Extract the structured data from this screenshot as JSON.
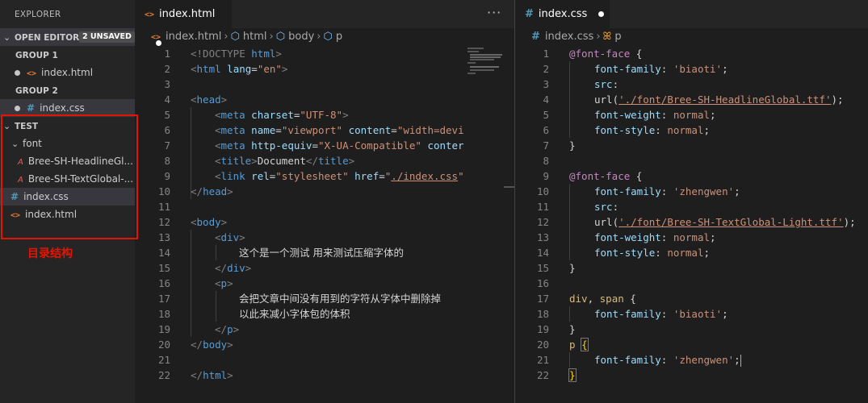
{
  "sidebar": {
    "title": "EXPLORER",
    "open_editors": {
      "label": "OPEN EDITORS",
      "badge": "2 UNSAVED"
    },
    "group1": {
      "label": "GROUP 1",
      "file": "index.html"
    },
    "group2": {
      "label": "GROUP 2",
      "file": "index.css"
    },
    "project": {
      "label": "TEST"
    },
    "tree": {
      "folder": "font",
      "font_files": [
        "Bree-SH-HeadlineGl...",
        "Bree-SH-TextGlobal-..."
      ],
      "css_file": "index.css",
      "html_file": "index.html"
    },
    "annotation": "目录结构"
  },
  "left_editor": {
    "tab": "index.html",
    "more": "···",
    "breadcrumb": [
      "index.html",
      "html",
      "body",
      "p"
    ],
    "line_numbers": [
      "1",
      "2",
      "3",
      "4",
      "5",
      "6",
      "7",
      "8",
      "9",
      "10",
      "11",
      "12",
      "13",
      "14",
      "15",
      "16",
      "17",
      "18",
      "19",
      "20",
      "21",
      "22"
    ]
  },
  "right_editor": {
    "tab": "index.css",
    "breadcrumb": [
      "index.css",
      "p"
    ],
    "line_numbers": [
      "1",
      "2",
      "3",
      "4",
      "5",
      "6",
      "7",
      "8",
      "9",
      "10",
      "11",
      "12",
      "13",
      "14",
      "15",
      "16",
      "17",
      "18",
      "19",
      "20",
      "21",
      "22"
    ]
  },
  "html_code": {
    "l1a": "<!DOCTYPE ",
    "l1b": "html",
    "l1c": ">",
    "l2a": "<",
    "l2b": "html",
    "l2c": " lang",
    "l2d": "=",
    "l2e": "\"en\"",
    "l2f": ">",
    "l4a": "<",
    "l4b": "head",
    "l4c": ">",
    "l5a": "<",
    "l5b": "meta",
    "l5c": " charset",
    "l5d": "=",
    "l5e": "\"UTF-8\"",
    "l5f": ">",
    "l6a": "<",
    "l6b": "meta",
    "l6c": " name",
    "l6d": "=",
    "l6e": "\"viewport\"",
    "l6f": " content",
    "l6g": "=",
    "l6h": "\"width=devi",
    "l7a": "<",
    "l7b": "meta",
    "l7c": " http-equiv",
    "l7d": "=",
    "l7e": "\"X-UA-Compatible\"",
    "l7f": " conter",
    "l8a": "<",
    "l8b": "title",
    "l8c": ">",
    "l8d": "Document",
    "l8e": "</",
    "l8f": "title",
    "l8g": ">",
    "l9a": "<",
    "l9b": "link",
    "l9c": " rel",
    "l9d": "=",
    "l9e": "\"stylesheet\"",
    "l9f": " href",
    "l9g": "=",
    "l9h": "\"",
    "l9i": "./index.css",
    "l9j": "\"",
    "l10a": "</",
    "l10b": "head",
    "l10c": ">",
    "l12a": "<",
    "l12b": "body",
    "l12c": ">",
    "l13a": "<",
    "l13b": "div",
    "l13c": ">",
    "l14": "这个是一个测试 用来测试压缩字体的",
    "l15a": "</",
    "l15b": "div",
    "l15c": ">",
    "l16a": "<",
    "l16b": "p",
    "l16c": ">",
    "l17": "会把文章中间没有用到的字符从字体中删除掉",
    "l18": "以此来减小字体包的体积",
    "l19a": "</",
    "l19b": "p",
    "l19c": ">",
    "l20a": "</",
    "l20b": "body",
    "l20c": ">",
    "l22a": "</",
    "l22b": "html",
    "l22c": ">"
  },
  "css_code": {
    "ff": "@font-face",
    "ob": " {",
    "cb": "}",
    "colon": ":",
    "semi": ";",
    "p_family": "font-family",
    "p_src": "src",
    "p_weight": "font-weight",
    "p_style": "font-style",
    "v_biaoti": "'biaoti'",
    "v_zhengwen": "'zhengwen'",
    "v_normal": "normal",
    "url1_a": "url(",
    "url1_b": "'./font/Bree-SH-HeadlineGlobal.ttf'",
    "url1_c": ");",
    "url2_a": "url(",
    "url2_b": "'./font/Bree-SH-TextGlobal-Light.ttf'",
    "url2_c": ");",
    "sel1": "div",
    "sel_comma": ", ",
    "sel2": "span",
    "sel3": "p"
  },
  "colors": {
    "accent_red": "#e51400",
    "html_icon": "#e37933",
    "css_icon": "#519aba"
  }
}
